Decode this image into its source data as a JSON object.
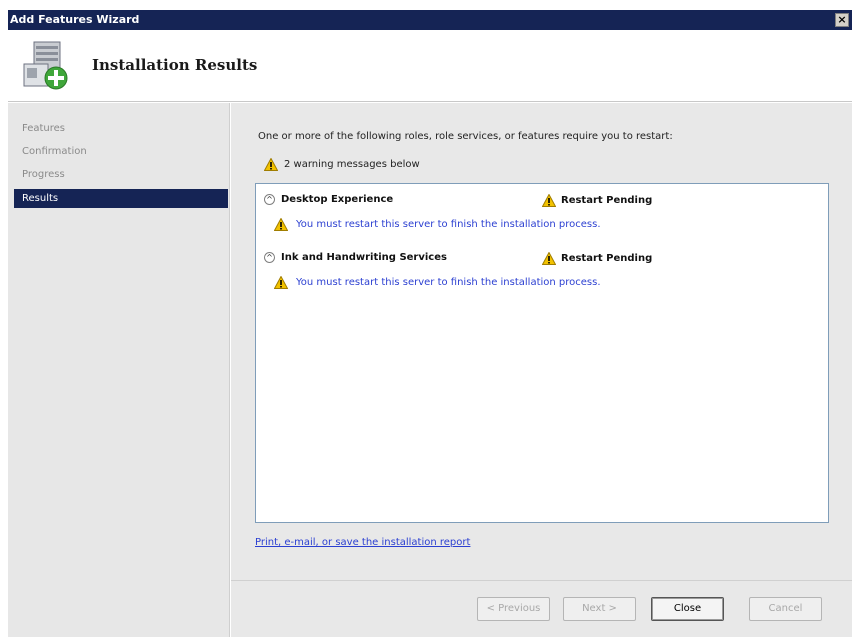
{
  "window": {
    "title": "Add Features Wizard",
    "close_glyph": "×"
  },
  "header": {
    "title": "Installation Results",
    "icon": "server-add-icon"
  },
  "sidebar": {
    "items": [
      {
        "label": "Features",
        "active": false
      },
      {
        "label": "Confirmation",
        "active": false
      },
      {
        "label": "Progress",
        "active": false
      },
      {
        "label": "Results",
        "active": true
      }
    ]
  },
  "content": {
    "restart_text": "One or more of the following roles, role services, or features require you to restart:",
    "warning_summary": "2 warning messages below",
    "results": [
      {
        "name": "Desktop Experience",
        "status": "Restart Pending",
        "message": "You must restart this server to finish the installation process."
      },
      {
        "name": "Ink and Handwriting Services",
        "status": "Restart Pending",
        "message": "You must restart this server to finish the installation process."
      }
    ],
    "report_link": "Print, e-mail, or save the installation report"
  },
  "footer": {
    "previous_label": "< Previous",
    "next_label": "Next >",
    "close_label": "Close",
    "cancel_label": "Cancel"
  },
  "colors": {
    "titlebar": "#152455",
    "link": "#2b3fd1",
    "warning": "#f2c200"
  }
}
